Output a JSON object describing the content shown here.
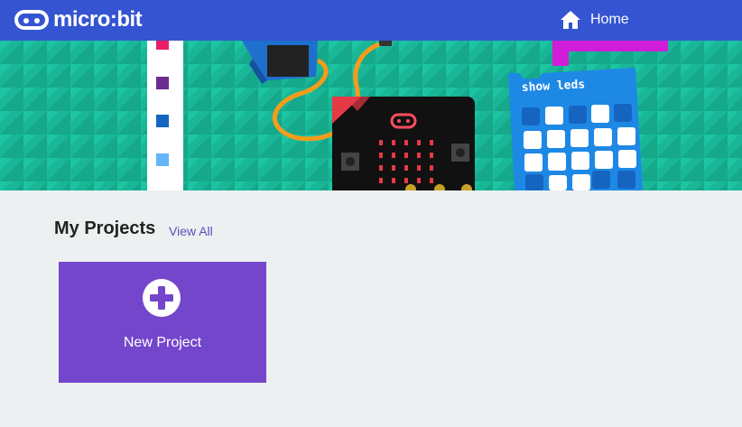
{
  "header": {
    "brand": "micro:bit",
    "home_label": "Home",
    "home_icon": "home-icon",
    "logo_icon": "microbit-logo-icon"
  },
  "hero": {
    "block_label": "show leds",
    "colors": {
      "background": "#19b798",
      "servo": "#1f6fcf",
      "board": "#111111",
      "block": "#1e88e5",
      "wire": "#f59c1a",
      "magenta": "#d01dd7"
    }
  },
  "projects": {
    "title": "My Projects",
    "view_all_label": "View All",
    "new_project_label": "New Project",
    "new_project_icon": "plus-circle-icon"
  },
  "theme": {
    "topbar": "#3454d1",
    "page_bg": "#ecf0f1",
    "card": "#7446cc",
    "link": "#5b4fb8"
  }
}
